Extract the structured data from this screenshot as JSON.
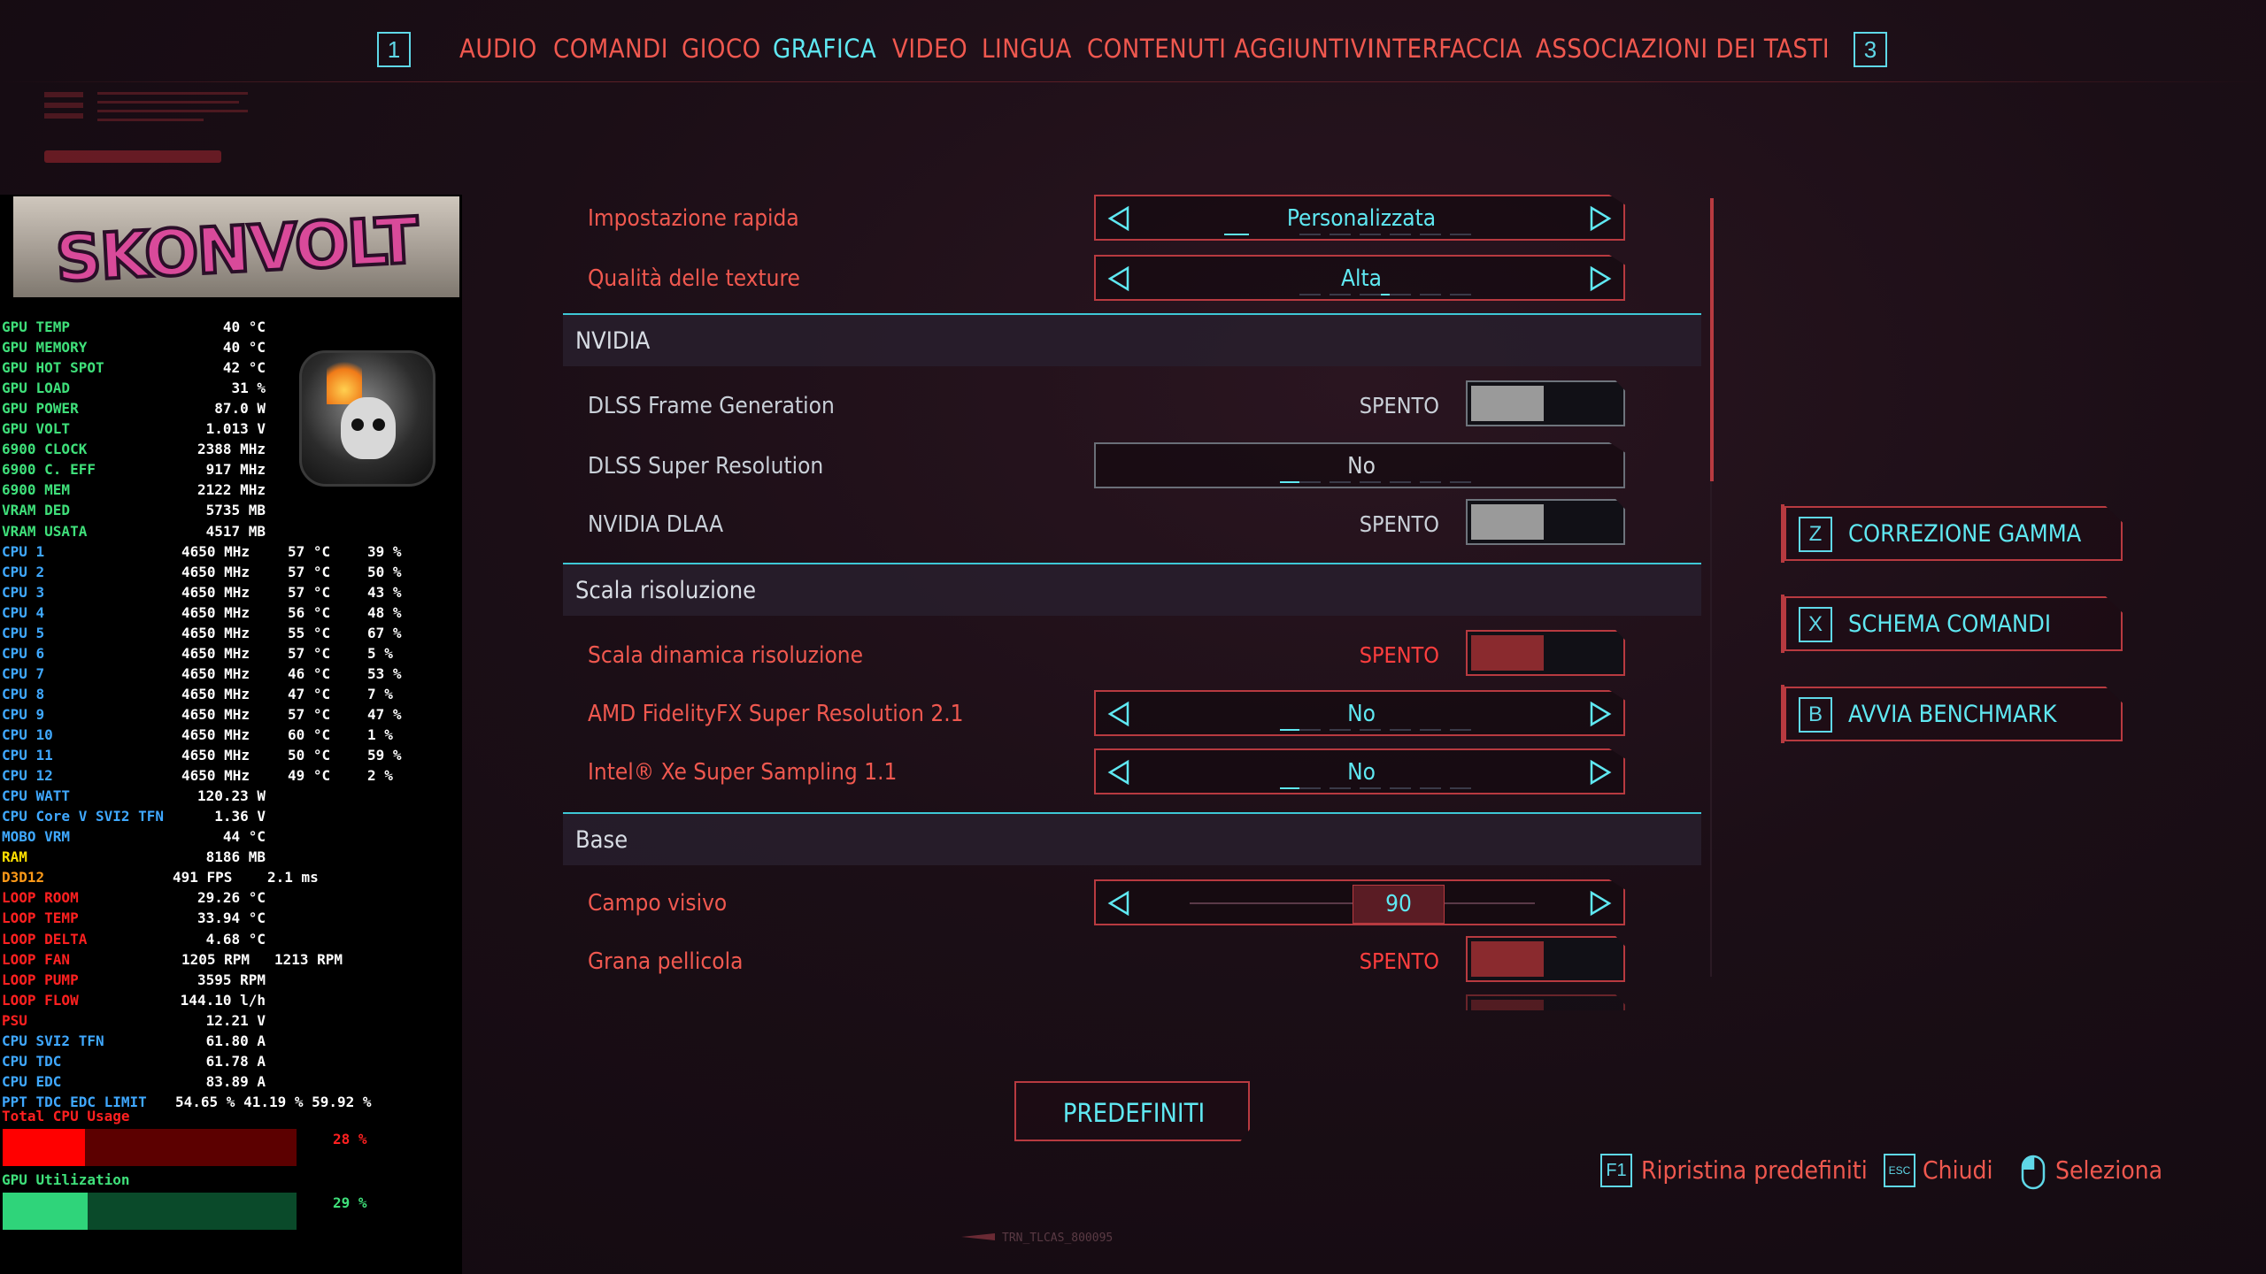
{
  "nav": {
    "left_key": "1",
    "right_key": "3",
    "tabs": [
      "AUDIO",
      "COMANDI",
      "GIOCO",
      "GRAFICA",
      "VIDEO",
      "LINGUA",
      "CONTENUTI AGGIUNTIVI",
      "INTERFACCIA",
      "ASSOCIAZIONI DEI TASTI"
    ],
    "active_tab": "GRAFICA"
  },
  "osd": {
    "banner_text": "SKONVOLT",
    "rows": [
      {
        "label": "GPU TEMP",
        "v1": "40 °C",
        "color": "green"
      },
      {
        "label": "GPU MEMORY",
        "v1": "40 °C",
        "color": "green"
      },
      {
        "label": "GPU HOT SPOT",
        "v1": "42 °C",
        "color": "green"
      },
      {
        "label": "GPU LOAD",
        "v1": "31 %",
        "color": "green"
      },
      {
        "label": "GPU POWER",
        "v1": "87.0 W",
        "color": "green"
      },
      {
        "label": "GPU VOLT",
        "v1": "1.013 V",
        "color": "green"
      },
      {
        "label": "6900 CLOCK",
        "v1": "2388 MHz",
        "color": "green"
      },
      {
        "label": "6900 C. EFF",
        "v1": "917 MHz",
        "color": "green"
      },
      {
        "label": "6900 MEM",
        "v1": "2122 MHz",
        "color": "green"
      },
      {
        "label": "VRAM DED",
        "v1": "5735 MB",
        "color": "green"
      },
      {
        "label": "VRAM USATA",
        "v1": "4517 MB",
        "color": "green"
      },
      {
        "label": "CPU 1",
        "v1": "4650 MHz",
        "v2": "57 °C",
        "v3": "39 %",
        "color": "blue"
      },
      {
        "label": "CPU 2",
        "v1": "4650 MHz",
        "v2": "57 °C",
        "v3": "50 %",
        "color": "blue"
      },
      {
        "label": "CPU 3",
        "v1": "4650 MHz",
        "v2": "57 °C",
        "v3": "43 %",
        "color": "blue"
      },
      {
        "label": "CPU 4",
        "v1": "4650 MHz",
        "v2": "56 °C",
        "v3": "48 %",
        "color": "blue"
      },
      {
        "label": "CPU 5",
        "v1": "4650 MHz",
        "v2": "55 °C",
        "v3": "67 %",
        "color": "blue"
      },
      {
        "label": "CPU 6",
        "v1": "4650 MHz",
        "v2": "57 °C",
        "v3": "5 %",
        "color": "blue"
      },
      {
        "label": "CPU 7",
        "v1": "4650 MHz",
        "v2": "46 °C",
        "v3": "53 %",
        "color": "blue"
      },
      {
        "label": "CPU 8",
        "v1": "4650 MHz",
        "v2": "47 °C",
        "v3": "7 %",
        "color": "blue"
      },
      {
        "label": "CPU 9",
        "v1": "4650 MHz",
        "v2": "57 °C",
        "v3": "47 %",
        "color": "blue"
      },
      {
        "label": "CPU 10",
        "v1": "4650 MHz",
        "v2": "60 °C",
        "v3": "1 %",
        "color": "blue"
      },
      {
        "label": "CPU 11",
        "v1": "4650 MHz",
        "v2": "50 °C",
        "v3": "59 %",
        "color": "blue"
      },
      {
        "label": "CPU 12",
        "v1": "4650 MHz",
        "v2": "49 °C",
        "v3": "2 %",
        "color": "blue"
      },
      {
        "label": "CPU WATT",
        "v1": "120.23 W",
        "color": "blue"
      },
      {
        "label": "CPU Core V SVI2 TFN",
        "v1": "1.36 V",
        "color": "blue"
      },
      {
        "label": "MOBO VRM",
        "v1": "44 °C",
        "color": "blue"
      },
      {
        "label": "RAM",
        "v1": "8186 MB",
        "color": "yellow"
      },
      {
        "label": "D3D12",
        "v1": "491 FPS",
        "v2": "2.1 ms",
        "color": "orange"
      },
      {
        "label": "LOOP ROOM",
        "v1": "29.26 °C",
        "color": "red"
      },
      {
        "label": "LOOP TEMP",
        "v1": "33.94 °C",
        "color": "red"
      },
      {
        "label": "LOOP DELTA",
        "v1": "4.68 °C",
        "color": "red"
      },
      {
        "label": "LOOP FAN",
        "v1": "1205 RPM",
        "v2": "1213 RPM",
        "color": "red"
      },
      {
        "label": "LOOP PUMP",
        "v1": "3595 RPM",
        "color": "red"
      },
      {
        "label": "LOOP FLOW",
        "v1": "144.10 l/h",
        "color": "red"
      },
      {
        "label": "PSU",
        "v1": "12.21 V",
        "color": "red"
      },
      {
        "label": "CPU SVI2 TFN",
        "v1": "61.80 A",
        "color": "blue"
      },
      {
        "label": "CPU TDC",
        "v1": "61.78 A",
        "color": "blue"
      },
      {
        "label": "CPU EDC",
        "v1": "83.89 A",
        "color": "blue"
      },
      {
        "label": "PPT TDC EDC LIMIT",
        "v1": "54.65 % 41.19 % 59.92 %",
        "color": "blue"
      }
    ],
    "cpu_usage_label": "Total CPU Usage",
    "cpu_usage_pct": "28 %",
    "cpu_usage_value": 0.28,
    "gpu_util_label": "GPU Utilization",
    "gpu_util_pct": "29 %",
    "gpu_util_value": 0.29
  },
  "settings": {
    "quick_preset": {
      "label": "Impostazione rapida",
      "value": "Personalizzata"
    },
    "texture_quality": {
      "label": "Qualità delle texture",
      "value": "Alta"
    },
    "nvidia_section": "NVIDIA",
    "dlss_fg": {
      "label": "DLSS Frame Generation",
      "value": "SPENTO"
    },
    "dlss_sr": {
      "label": "DLSS Super Resolution",
      "value": "No"
    },
    "dlaa": {
      "label": "NVIDIA DLAA",
      "value": "SPENTO"
    },
    "res_section": "Scala risoluzione",
    "dynamic_res": {
      "label": "Scala dinamica risoluzione",
      "value": "SPENTO"
    },
    "fsr": {
      "label": "AMD FidelityFX Super Resolution 2.1",
      "value": "No"
    },
    "xess": {
      "label": "Intel® Xe Super Sampling 1.1",
      "value": "No"
    },
    "base_section": "Base",
    "fov": {
      "label": "Campo visivo",
      "value": "90"
    },
    "film_grain": {
      "label": "Grana pellicola",
      "value": "SPENTO"
    }
  },
  "side_buttons": [
    {
      "key": "Z",
      "label": "CORREZIONE GAMMA"
    },
    {
      "key": "X",
      "label": "SCHEMA COMANDI"
    },
    {
      "key": "B",
      "label": "AVVIA BENCHMARK"
    }
  ],
  "defaults_button": "PREDEFINITI",
  "hints": {
    "restore": {
      "key": "F1",
      "label": "Ripristina predefiniti"
    },
    "close": {
      "key": "ESC",
      "label": "Chiudi"
    },
    "select": {
      "label": "Seleziona"
    }
  },
  "footer_tag": "TRN_TLCAS_800095",
  "colors": {
    "accent_cyan": "#5fe8f2",
    "accent_red": "#f0584f",
    "border_red": "#b83a40"
  }
}
